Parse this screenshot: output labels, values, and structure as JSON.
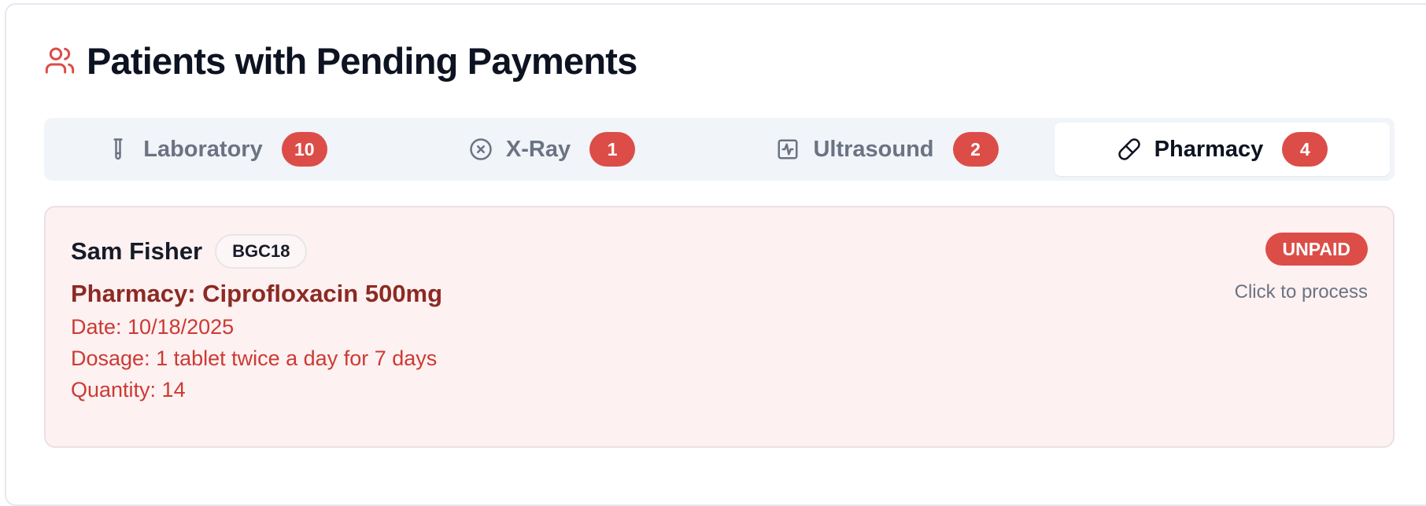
{
  "page": {
    "title": "Patients with Pending Payments",
    "title_icon": "users-icon"
  },
  "colors": {
    "accent_red": "#dc4d48",
    "title_dark": "#0d1321",
    "muted": "#6b7383",
    "card_bg": "#fdf1f1",
    "service_title": "#8c2a23",
    "detail_text": "#cc3a33"
  },
  "tabs": [
    {
      "label": "Laboratory",
      "count": "10",
      "icon": "test-tube-icon",
      "active": false
    },
    {
      "label": "X-Ray",
      "count": "1",
      "icon": "circle-x-icon",
      "active": false
    },
    {
      "label": "Ultrasound",
      "count": "2",
      "icon": "activity-square-icon",
      "active": false
    },
    {
      "label": "Pharmacy",
      "count": "4",
      "icon": "pill-icon",
      "active": true
    }
  ],
  "records": [
    {
      "patient_name": "Sam Fisher",
      "patient_id": "BGC18",
      "service": "Pharmacy: Ciprofloxacin 500mg",
      "date": "Date: 10/18/2025",
      "dosage": "Dosage: 1 tablet twice a day for 7 days",
      "quantity": "Quantity: 14",
      "status": "UNPAID",
      "hint": "Click to process"
    }
  ]
}
